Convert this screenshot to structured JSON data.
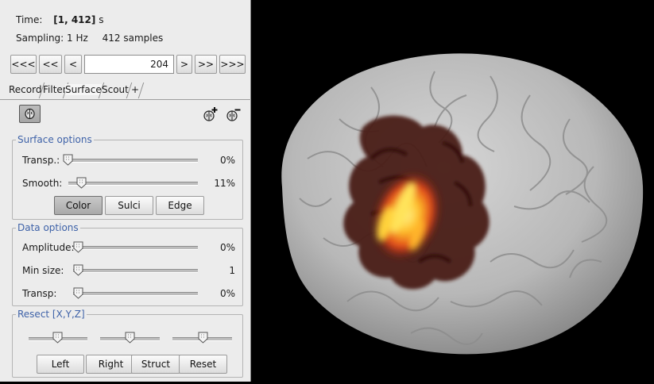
{
  "time": {
    "label": "Time:",
    "value": "[1, 412]",
    "unit": "s"
  },
  "sampling": {
    "label": "Sampling: 1 Hz",
    "count": "412 samples"
  },
  "nav": {
    "buttons": [
      "<<<",
      "<<",
      "<",
      ">",
      ">>",
      ">>>"
    ],
    "current": "204"
  },
  "tabs": [
    "Record",
    "Filter",
    "Surface",
    "Scout",
    "+"
  ],
  "surface_options": {
    "title": "Surface options",
    "transp_label": "Transp.:",
    "transp_value": "0%",
    "transp_level": 0,
    "smooth_label": "Smooth:",
    "smooth_value": "11%",
    "smooth_level": 0.11,
    "buttons": [
      "Color",
      "Sulci",
      "Edge"
    ]
  },
  "data_options": {
    "title": "Data options",
    "amplitude_label": "Amplitude:",
    "amplitude_value": "0%",
    "amplitude_level": 0,
    "minsize_label": "Min size:",
    "minsize_value": "1",
    "minsize_level": 0,
    "transp_label": "Transp:",
    "transp_value": "0%",
    "transp_level": 0
  },
  "resect": {
    "title": "Resect [X,Y,Z]",
    "slider_levels": [
      0.5,
      0.5,
      0.5
    ],
    "buttons": [
      "Left",
      "Right",
      "Struct",
      "Reset"
    ]
  },
  "icons": [
    "brain-toggle-icon",
    "add-surface-icon",
    "remove-surface-icon"
  ],
  "colors": {
    "panel_bg": "#ececec",
    "legend_blue": "#3e62a8",
    "activation_hot": "#ffd23a",
    "activation_dark": "#4a1a14"
  }
}
